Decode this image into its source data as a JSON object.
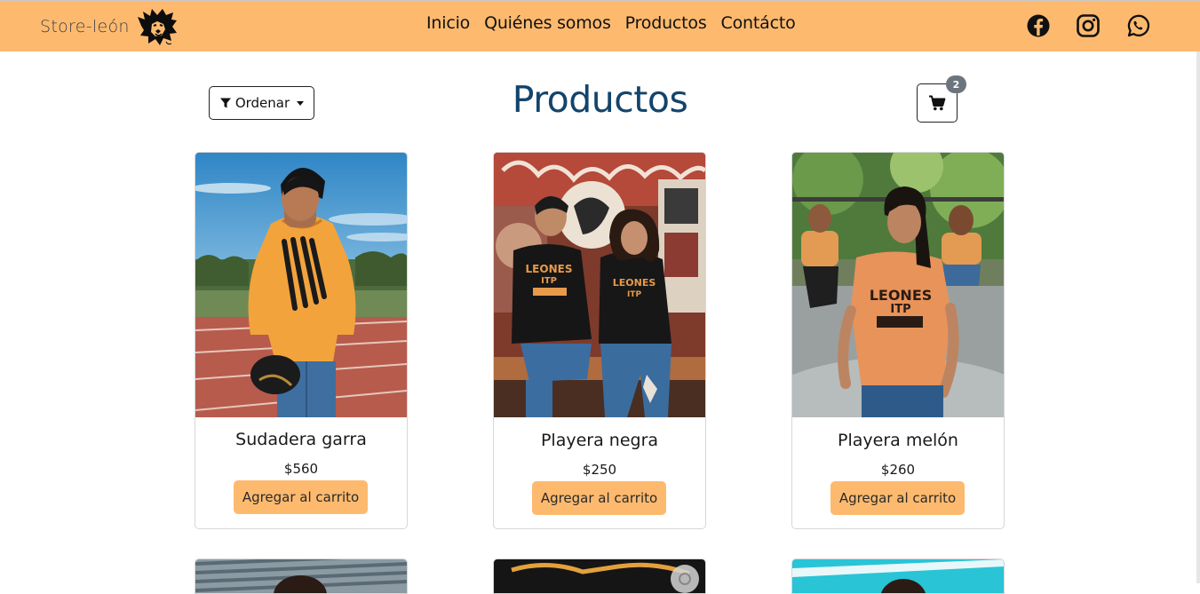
{
  "brand": {
    "name": "Store-león",
    "logo_icon": "lion-head-icon"
  },
  "nav": {
    "links": [
      "Inicio",
      "Quiénes somos",
      "Productos",
      "Contácto"
    ]
  },
  "social": {
    "facebook": "facebook-icon",
    "instagram": "instagram-icon",
    "whatsapp": "whatsapp-icon"
  },
  "toolbar": {
    "sort_label": "Ordenar",
    "sort_icon": "filter-icon"
  },
  "page": {
    "title": "Productos"
  },
  "cart": {
    "icon": "cart-icon",
    "count": "2"
  },
  "products": [
    {
      "name": "Sudadera garra",
      "price": "$560",
      "button": "Agregar al carrito"
    },
    {
      "name": "Playera negra",
      "price": "$250",
      "button": "Agregar al carrito"
    },
    {
      "name": "Playera melón",
      "price": "$260",
      "button": "Agregar al carrito"
    }
  ],
  "colors": {
    "navbar": "#fdba6f",
    "title": "#13446b",
    "button": "#fdba6f",
    "badge": "#6c757d"
  }
}
